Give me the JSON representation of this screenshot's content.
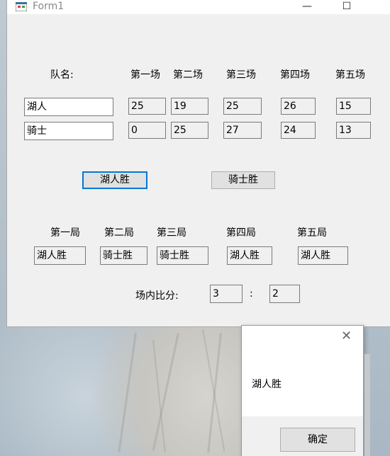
{
  "window": {
    "title": "Form1",
    "minimize": "—",
    "maximize": "☐"
  },
  "headers": {
    "team_name": "队名:",
    "games": [
      "第一场",
      "第二场",
      "第三场",
      "第四场",
      "第五场"
    ]
  },
  "teams": [
    {
      "name": "湖人",
      "scores": [
        "25",
        "19",
        "25",
        "26",
        "15"
      ]
    },
    {
      "name": "骑士",
      "scores": [
        "0",
        "25",
        "27",
        "24",
        "13"
      ]
    }
  ],
  "buttons": {
    "lakers_win": "湖人胜",
    "cavs_win": "骑士胜"
  },
  "rounds": {
    "labels": [
      "第一局",
      "第二局",
      "第三局",
      "第四局",
      "第五局"
    ],
    "results": [
      "湖人胜",
      "骑士胜",
      "骑士胜",
      "湖人胜",
      "湖人胜"
    ]
  },
  "score": {
    "label": "场内比分:",
    "left": "3",
    "separator": ":",
    "right": "2"
  },
  "message_box": {
    "text": "湖人胜",
    "ok": "确定",
    "close": "✕"
  }
}
